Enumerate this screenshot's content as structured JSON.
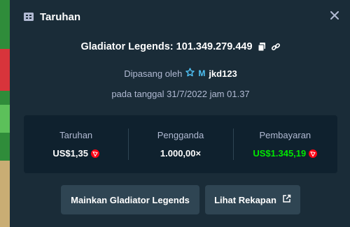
{
  "modal": {
    "title": "Taruhan",
    "game_name_prefix": "Gladiator Legends: ",
    "bet_id": "101.349.279.449",
    "placed_by_label": "Dipasang oleh",
    "vip_badge": "M",
    "username": "jkd123",
    "date_text": "pada tanggal 31/7/2022 jam 01.37",
    "stats": [
      {
        "label": "Taruhan",
        "value": "US$1,35",
        "coin": true,
        "color": "white"
      },
      {
        "label": "Pengganda",
        "value": "1.000,00×",
        "coin": false,
        "color": "white"
      },
      {
        "label": "Pembayaran",
        "value": "US$1.345,19",
        "coin": true,
        "color": "green"
      }
    ],
    "play_button": "Mainkan Gladiator Legends",
    "recap_button": "Lihat Rekapan"
  },
  "icons": {
    "ticket": "ticket-icon",
    "close": "close-icon",
    "copy": "copy-icon",
    "link": "link-icon",
    "vip_star": "star-icon",
    "coin": "tron-coin-icon",
    "external": "external-link-icon"
  },
  "colors": {
    "background": "#1a2c38",
    "panel": "#0f212e",
    "button": "#2f4553",
    "muted_text": "#b1bad3",
    "payout_green": "#00e701",
    "coin_red": "#ff0013",
    "vip_blue": "#4fc3f7"
  }
}
